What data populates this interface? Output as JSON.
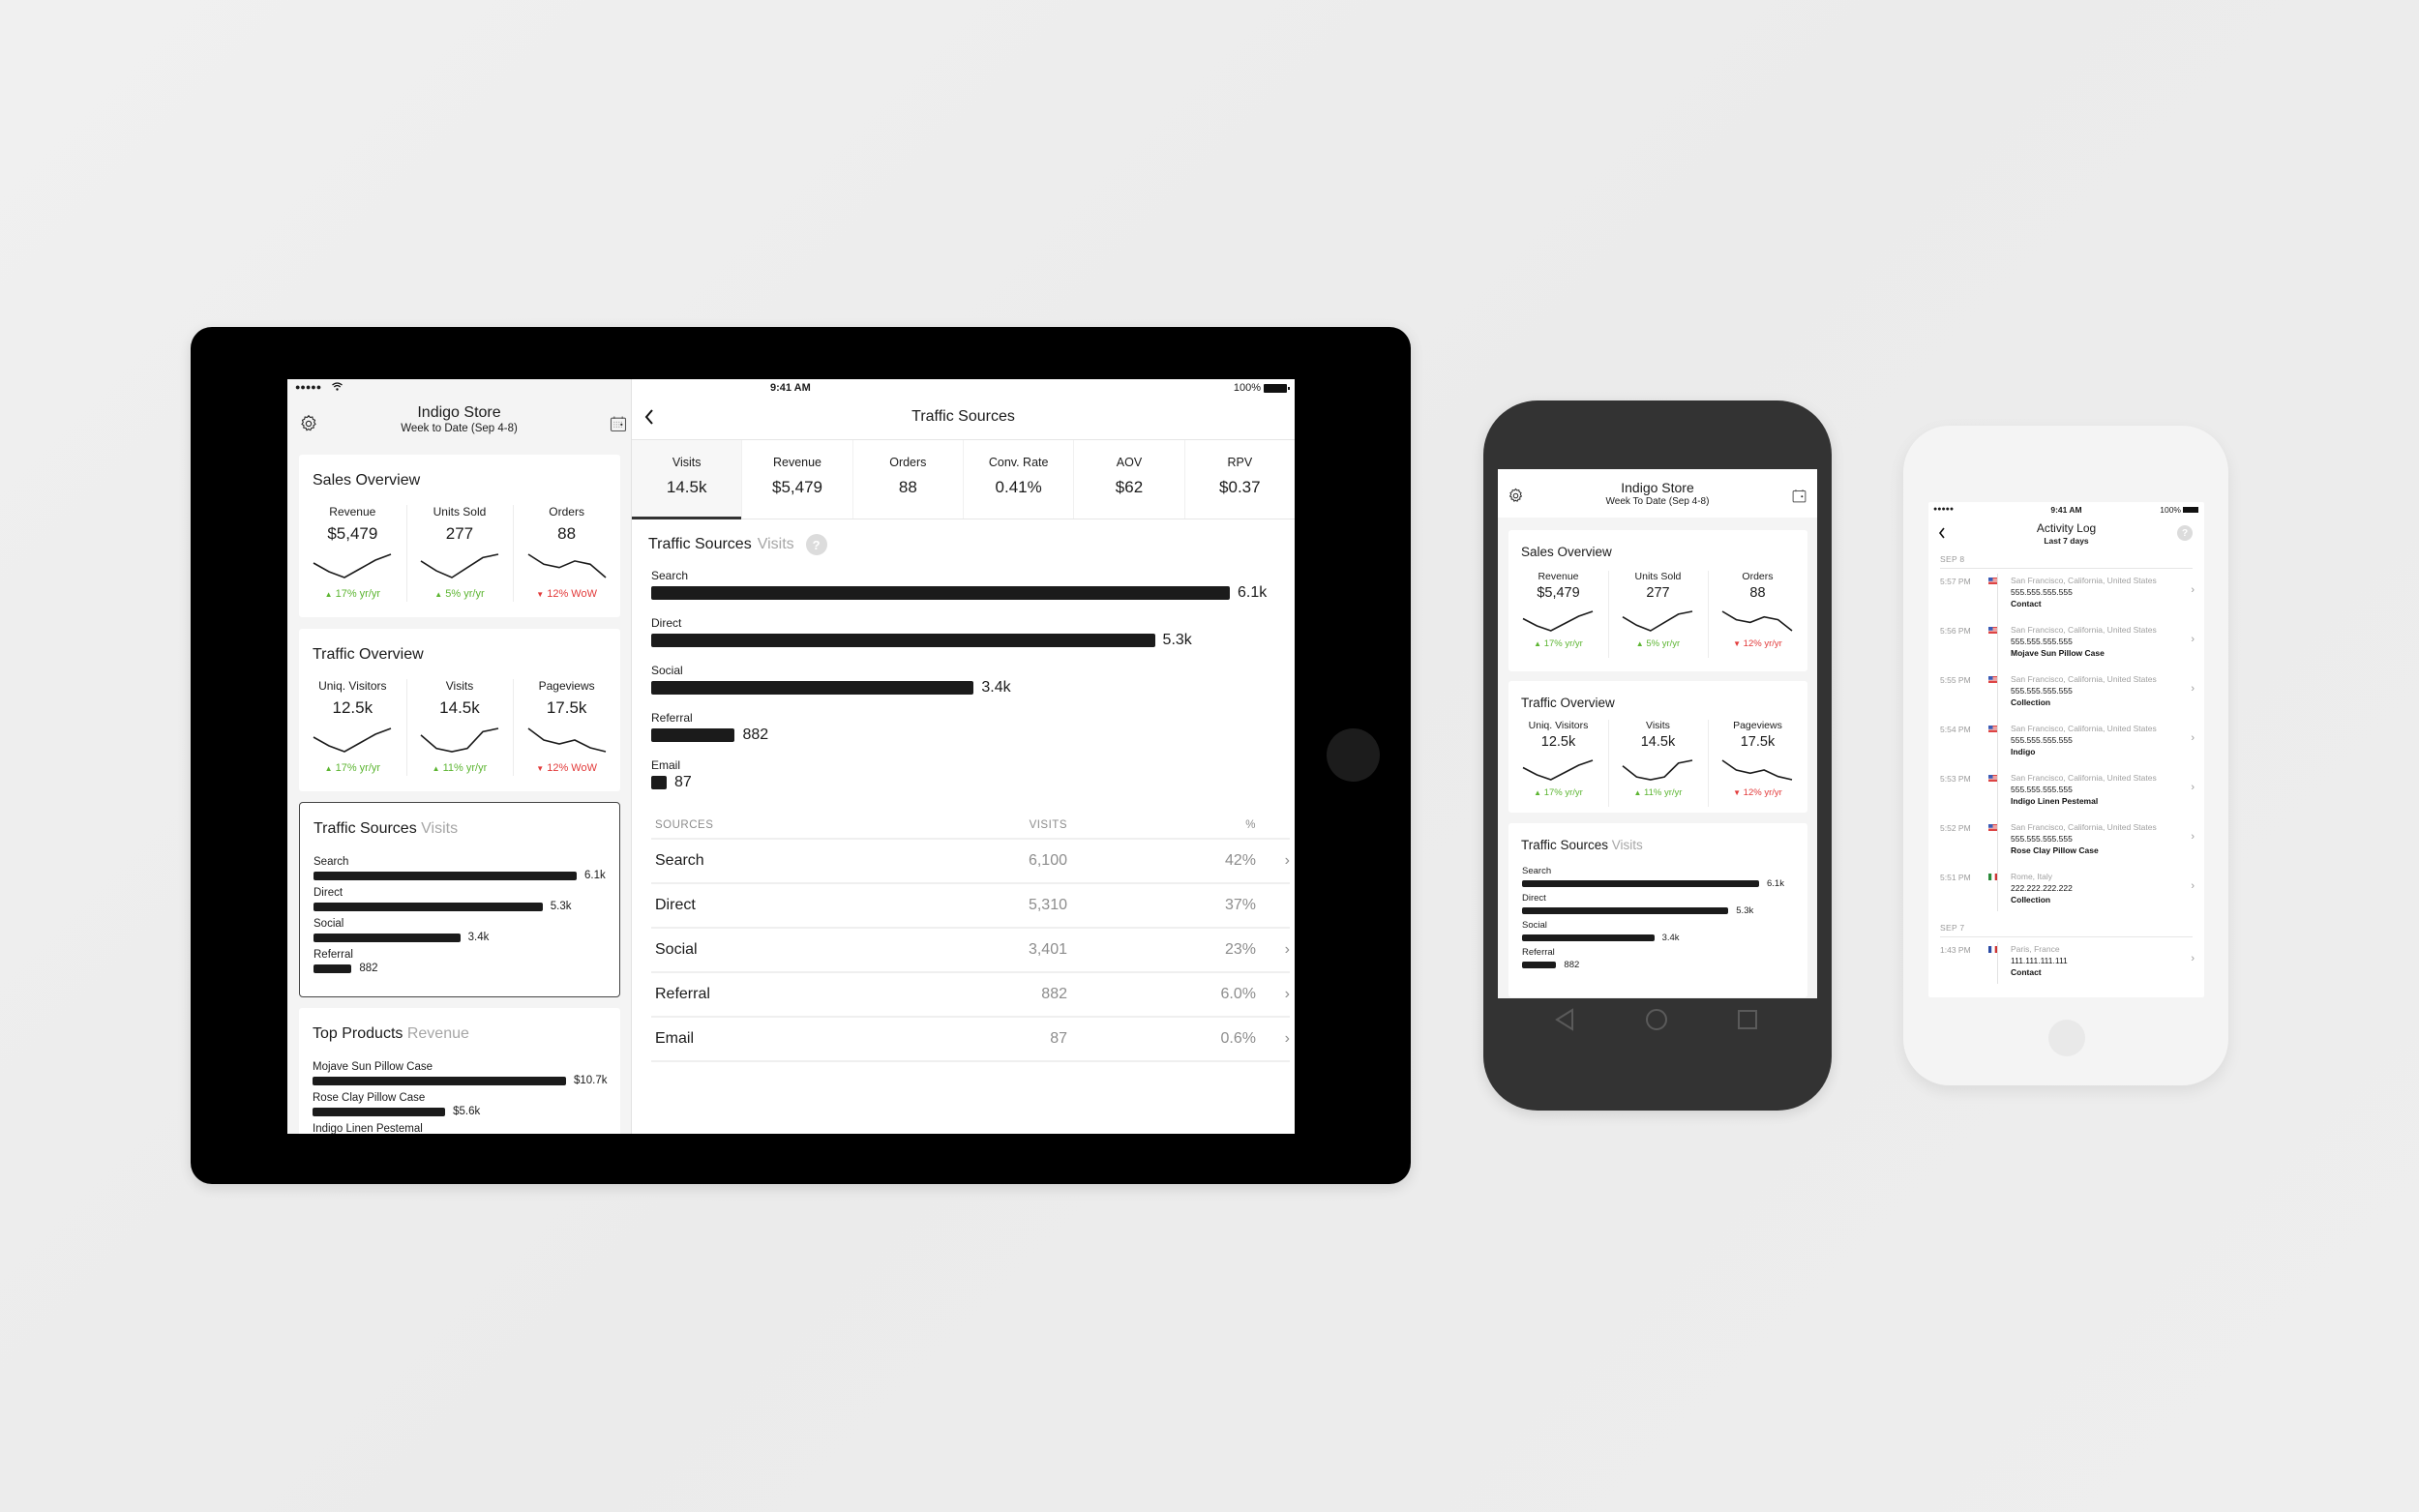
{
  "ipad": {
    "status": {
      "signal": "●●●●●",
      "time": "9:41 AM",
      "battery": "100%"
    },
    "header": {
      "title": "Indigo Store",
      "subtitle": "Week to Date (Sep 4-8)"
    },
    "sales_overview": {
      "title": "Sales Overview",
      "metrics": [
        {
          "label": "Revenue",
          "value": "$5,479",
          "delta": "17% yr/yr",
          "direction": "up",
          "trend": [
            6,
            3,
            1,
            4,
            7,
            9
          ]
        },
        {
          "label": "Units Sold",
          "value": "277",
          "delta": "5% yr/yr",
          "direction": "up",
          "trend": [
            7,
            4,
            2,
            5,
            8,
            9
          ]
        },
        {
          "label": "Orders",
          "value": "88",
          "delta": "12% WoW",
          "direction": "down",
          "trend": [
            9,
            6,
            5,
            7,
            6,
            2
          ]
        }
      ]
    },
    "traffic_overview": {
      "title": "Traffic Overview",
      "metrics": [
        {
          "label": "Uniq. Visitors",
          "value": "12.5k",
          "delta": "17% yr/yr",
          "direction": "up",
          "trend": [
            6,
            3,
            1,
            4,
            7,
            9
          ]
        },
        {
          "label": "Visits",
          "value": "14.5k",
          "delta": "11% yr/yr",
          "direction": "up",
          "trend": [
            7,
            3,
            2,
            3,
            8,
            9
          ]
        },
        {
          "label": "Pageviews",
          "value": "17.5k",
          "delta": "12% WoW",
          "direction": "down",
          "trend": [
            9,
            6,
            5,
            6,
            4,
            3
          ]
        }
      ]
    },
    "traffic_sources": {
      "title": "Traffic Sources",
      "subtitle": "Visits",
      "items": [
        {
          "label": "Search",
          "value": 6100,
          "display": "6.1k"
        },
        {
          "label": "Direct",
          "value": 5310,
          "display": "5.3k"
        },
        {
          "label": "Social",
          "value": 3401,
          "display": "3.4k"
        },
        {
          "label": "Referral",
          "value": 882,
          "display": "882"
        }
      ]
    },
    "top_products": {
      "title": "Top Products",
      "subtitle": "Revenue",
      "items": [
        {
          "label": "Mojave Sun Pillow Case",
          "value": 10700,
          "display": "$10.7k"
        },
        {
          "label": "Rose Clay Pillow Case",
          "value": 5600,
          "display": "$5.6k"
        },
        {
          "label": "Indigo Linen Pestemal",
          "value": 0,
          "display": ""
        }
      ]
    },
    "detail": {
      "nav_title": "Traffic Sources",
      "back_label": "‹",
      "tabs": [
        {
          "label": "Visits",
          "value": "14.5k",
          "active": true
        },
        {
          "label": "Revenue",
          "value": "$5,479"
        },
        {
          "label": "Orders",
          "value": "88"
        },
        {
          "label": "Conv. Rate",
          "value": "0.41%"
        },
        {
          "label": "AOV",
          "value": "$62"
        },
        {
          "label": "RPV",
          "value": "$0.37"
        }
      ],
      "chart_title": "Traffic Sources",
      "chart_subtitle": "Visits",
      "help_label": "?",
      "bars": [
        {
          "label": "Search",
          "value": 6100,
          "display": "6.1k"
        },
        {
          "label": "Direct",
          "value": 5310,
          "display": "5.3k"
        },
        {
          "label": "Social",
          "value": 3401,
          "display": "3.4k"
        },
        {
          "label": "Referral",
          "value": 882,
          "display": "882"
        },
        {
          "label": "Email",
          "value": 87,
          "display": "87"
        }
      ],
      "table": {
        "headers": [
          "SOURCES",
          "VISITS",
          "%"
        ],
        "rows": [
          {
            "source": "Search",
            "visits": "6,100",
            "pct": "42%",
            "chevron": true
          },
          {
            "source": "Direct",
            "visits": "5,310",
            "pct": "37%",
            "chevron": false
          },
          {
            "source": "Social",
            "visits": "3,401",
            "pct": "23%",
            "chevron": true
          },
          {
            "source": "Referral",
            "visits": "882",
            "pct": "6.0%",
            "chevron": true
          },
          {
            "source": "Email",
            "visits": "87",
            "pct": "0.6%",
            "chevron": true
          }
        ]
      }
    }
  },
  "android": {
    "header": {
      "title": "Indigo Store",
      "subtitle": "Week To Date (Sep 4-8)"
    },
    "sales_overview": {
      "title": "Sales Overview",
      "metrics": [
        {
          "label": "Revenue",
          "value": "$5,479",
          "delta": "17% yr/yr",
          "direction": "up",
          "trend": [
            6,
            3,
            1,
            4,
            7,
            9
          ]
        },
        {
          "label": "Units Sold",
          "value": "277",
          "delta": "5% yr/yr",
          "direction": "up",
          "trend": [
            7,
            4,
            2,
            5,
            8,
            9
          ]
        },
        {
          "label": "Orders",
          "value": "88",
          "delta": "12% yr/yr",
          "direction": "down",
          "trend": [
            9,
            6,
            5,
            7,
            6,
            2
          ]
        }
      ]
    },
    "traffic_overview": {
      "title": "Traffic Overview",
      "metrics": [
        {
          "label": "Uniq. Visitors",
          "value": "12.5k",
          "delta": "17% yr/yr",
          "direction": "up",
          "trend": [
            6,
            3,
            1,
            4,
            7,
            9
          ]
        },
        {
          "label": "Visits",
          "value": "14.5k",
          "delta": "11% yr/yr",
          "direction": "up",
          "trend": [
            7,
            3,
            2,
            3,
            8,
            9
          ]
        },
        {
          "label": "Pageviews",
          "value": "17.5k",
          "delta": "12% yr/yr",
          "direction": "down",
          "trend": [
            9,
            6,
            5,
            6,
            4,
            3
          ]
        }
      ]
    },
    "traffic_sources": {
      "title": "Traffic Sources",
      "subtitle": "Visits",
      "items": [
        {
          "label": "Search",
          "value": 6100,
          "display": "6.1k"
        },
        {
          "label": "Direct",
          "value": 5310,
          "display": "5.3k"
        },
        {
          "label": "Social",
          "value": 3401,
          "display": "3.4k"
        },
        {
          "label": "Referral",
          "value": 882,
          "display": "882"
        }
      ]
    },
    "nav_buttons": [
      "back",
      "home",
      "recents"
    ]
  },
  "iphone": {
    "status": {
      "signal": "●●●●●",
      "time": "9:41 AM",
      "battery": "100%"
    },
    "header": {
      "title": "Activity Log",
      "subtitle": "Last 7 days",
      "help_label": "?"
    },
    "groups": [
      {
        "date": "SEP 8",
        "entries": [
          {
            "time": "5:57 PM",
            "flag": "us",
            "location": "San Francisco, California, United States",
            "ip": "555.555.555.555",
            "item": "Contact"
          },
          {
            "time": "5:56 PM",
            "flag": "us",
            "location": "San Francisco, California, United States",
            "ip": "555.555.555.555",
            "item": "Mojave Sun Pillow Case"
          },
          {
            "time": "5:55 PM",
            "flag": "us",
            "location": "San Francisco, California, United States",
            "ip": "555.555.555.555",
            "item": "Collection"
          },
          {
            "time": "5:54 PM",
            "flag": "us",
            "location": "San Francisco, California, United States",
            "ip": "555.555.555.555",
            "item": "Indigo"
          },
          {
            "time": "5:53 PM",
            "flag": "us",
            "location": "San Francisco, California, United States",
            "ip": "555.555.555.555",
            "item": "Indigo Linen Pestemal"
          },
          {
            "time": "5:52 PM",
            "flag": "us",
            "location": "San Francisco, California, United States",
            "ip": "555.555.555.555",
            "item": "Rose Clay Pillow Case"
          },
          {
            "time": "5:51 PM",
            "flag": "it",
            "location": "Rome, Italy",
            "ip": "222.222.222.222",
            "item": "Collection"
          }
        ]
      },
      {
        "date": "SEP 7",
        "entries": [
          {
            "time": "1:43 PM",
            "flag": "fr",
            "location": "Paris, France",
            "ip": "111.111.111.111",
            "item": "Contact"
          }
        ]
      }
    ]
  },
  "colors": {
    "up": "#5cb531",
    "down": "#e23a3a",
    "bar": "#1b1b1b",
    "muted": "#a6a6a6"
  }
}
